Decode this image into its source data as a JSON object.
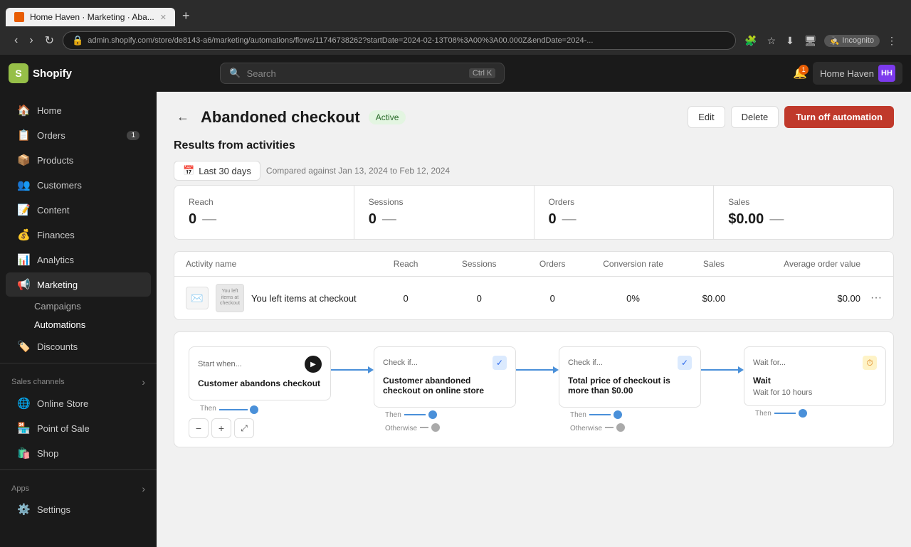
{
  "browser": {
    "tab_title": "Home Haven · Marketing · Aba...",
    "url": "admin.shopify.com/store/de8143-a6/marketing/automations/flows/11746738262?startDate=2024-02-13T08%3A00%3A00.000Z&endDate=2024-...",
    "incognito_label": "Incognito",
    "new_tab_label": "+"
  },
  "header": {
    "logo_text": "Shopify",
    "search_placeholder": "Search",
    "search_shortcut": "Ctrl K",
    "store_name": "Home Haven",
    "store_initials": "HH",
    "notification_count": "1"
  },
  "sidebar": {
    "items": [
      {
        "id": "home",
        "label": "Home",
        "icon": "🏠"
      },
      {
        "id": "orders",
        "label": "Orders",
        "icon": "📋",
        "badge": "1"
      },
      {
        "id": "products",
        "label": "Products",
        "icon": "📦"
      },
      {
        "id": "customers",
        "label": "Customers",
        "icon": "👥"
      },
      {
        "id": "content",
        "label": "Content",
        "icon": "📝"
      },
      {
        "id": "finances",
        "label": "Finances",
        "icon": "💰"
      },
      {
        "id": "analytics",
        "label": "Analytics",
        "icon": "📊"
      },
      {
        "id": "marketing",
        "label": "Marketing",
        "icon": "📢",
        "active": true
      },
      {
        "id": "discounts",
        "label": "Discounts",
        "icon": "🏷️"
      }
    ],
    "marketing_sub": [
      {
        "id": "campaigns",
        "label": "Campaigns"
      },
      {
        "id": "automations",
        "label": "Automations",
        "active": true
      }
    ],
    "sales_channels_label": "Sales channels",
    "sales_channels": [
      {
        "id": "online-store",
        "label": "Online Store",
        "icon": "🌐"
      },
      {
        "id": "pos",
        "label": "Point of Sale",
        "icon": "🏪"
      },
      {
        "id": "shop",
        "label": "Shop",
        "icon": "🛍️"
      }
    ],
    "apps_label": "Apps",
    "settings_label": "Settings"
  },
  "page": {
    "back_label": "←",
    "title": "Abandoned checkout",
    "status": "Active",
    "edit_label": "Edit",
    "delete_label": "Delete",
    "turn_off_label": "Turn off automation",
    "results_title": "Results from activities",
    "date_range": "Last 30 days",
    "date_icon": "📅",
    "compared_text": "Compared against Jan 13, 2024 to Feb 12, 2024"
  },
  "metrics": [
    {
      "label": "Reach",
      "value": "0",
      "dash": "—"
    },
    {
      "label": "Sessions",
      "value": "0",
      "dash": "—"
    },
    {
      "label": "Orders",
      "value": "0",
      "dash": "—"
    },
    {
      "label": "Sales",
      "value": "$0.00",
      "dash": "—"
    }
  ],
  "table": {
    "headers": [
      "Activity name",
      "Reach",
      "Sessions",
      "Orders",
      "Conversion rate",
      "Sales",
      "Average order value",
      ""
    ],
    "rows": [
      {
        "name": "You left items at checkout",
        "reach": "0",
        "sessions": "0",
        "orders": "0",
        "conversion": "0%",
        "sales": "$0.00",
        "avg_order": "$0.00"
      }
    ]
  },
  "flow": {
    "nodes": [
      {
        "type": "trigger",
        "header": "Start when...",
        "title": "Customer abandons checkout",
        "then_label": "Then"
      },
      {
        "type": "condition",
        "header": "Check if...",
        "title": "Customer abandoned checkout on online store",
        "then_label": "Then",
        "otherwise_label": "Otherwise"
      },
      {
        "type": "condition",
        "header": "Check if...",
        "title": "Total price of checkout is more than $0.00",
        "then_label": "Then",
        "otherwise_label": "Otherwise"
      },
      {
        "type": "wait",
        "header": "Wait for...",
        "title": "Wait",
        "desc": "Wait for 10 hours",
        "then_label": "Then"
      }
    ]
  },
  "zoom": {
    "zoom_out": "−",
    "zoom_in": "+",
    "expand": "⤢"
  }
}
